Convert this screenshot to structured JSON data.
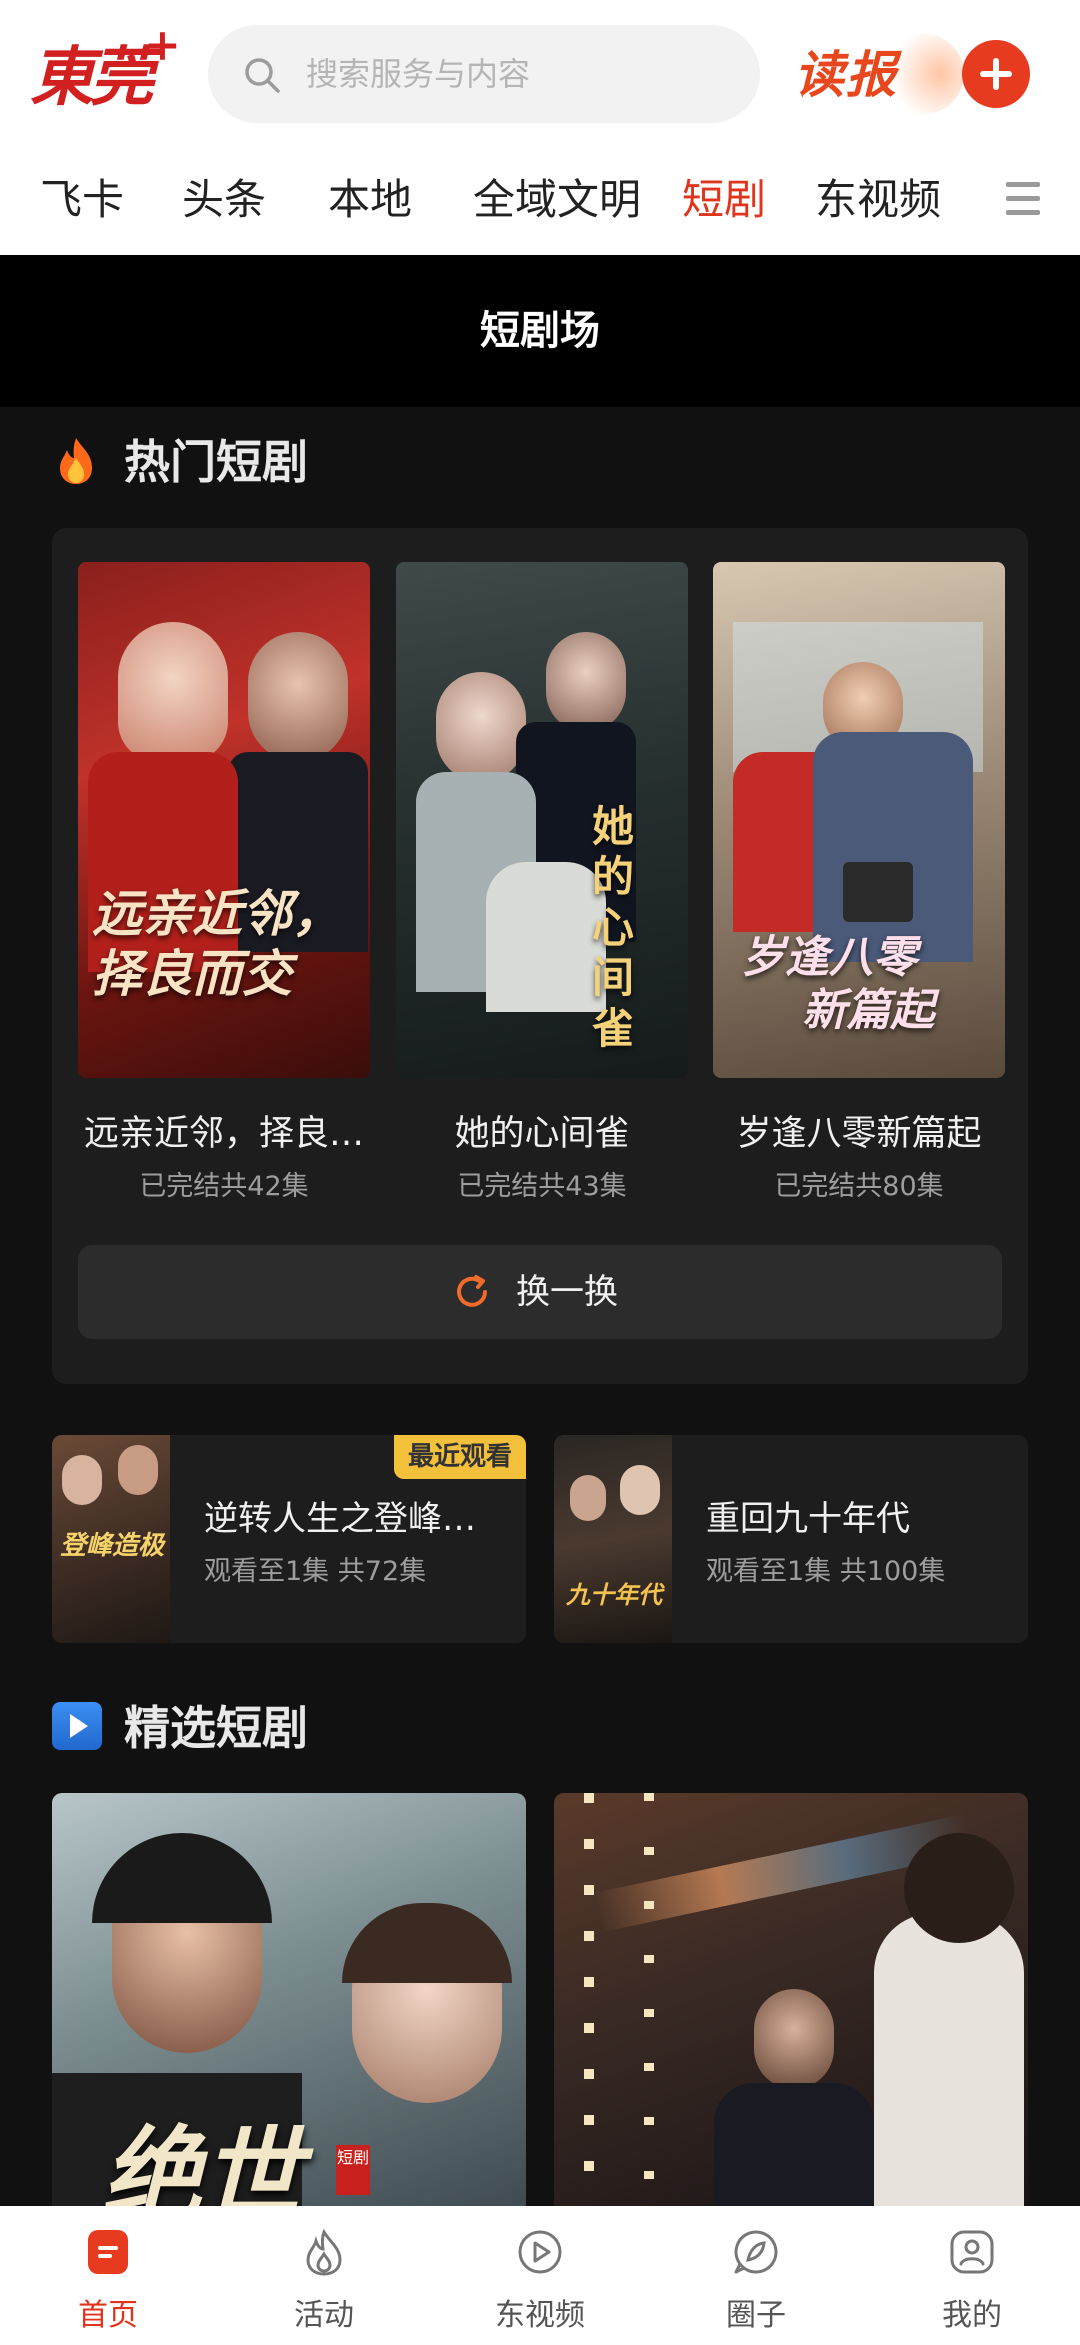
{
  "header": {
    "logo": "東莞",
    "logo_plus": "+",
    "search_placeholder": "搜索服务与内容",
    "dubao": "读报"
  },
  "tabs": [
    {
      "label": "飞卡",
      "active": false
    },
    {
      "label": "头条",
      "active": false
    },
    {
      "label": "本地",
      "active": false
    },
    {
      "label": "全域文明",
      "active": false
    },
    {
      "label": "短剧",
      "active": true
    },
    {
      "label": "东视频",
      "active": false
    }
  ],
  "page_title": "短剧场",
  "hot": {
    "title": "热门短剧",
    "items": [
      {
        "name": "远亲近邻，择良…",
        "status": "已完结共42集",
        "poster_text": "远亲近邻，择良而交"
      },
      {
        "name": "她的心间雀",
        "status": "已完结共43集",
        "poster_text": "她的心间雀"
      },
      {
        "name": "岁逢八零新篇起",
        "status": "已完结共80集",
        "poster_text": "岁逢八零 新篇起"
      }
    ],
    "refresh_label": "换一换"
  },
  "recent": {
    "badge": "最近观看",
    "items": [
      {
        "name": "逆转人生之登峰…",
        "progress": "观看至1集 共72集",
        "thumb_text": "登峰造极"
      },
      {
        "name": "重回九十年代",
        "progress": "观看至1集 共100集",
        "thumb_text": "九十年代"
      }
    ]
  },
  "featured": {
    "title": "精选短剧",
    "items": [
      {
        "poster_text": "绝世",
        "tag": "短剧"
      },
      {
        "poster_text": ""
      }
    ]
  },
  "bottom_nav": [
    {
      "label": "首页",
      "icon": "home-icon",
      "active": true
    },
    {
      "label": "活动",
      "icon": "flame-icon",
      "active": false
    },
    {
      "label": "东视频",
      "icon": "play-circle-icon",
      "active": false
    },
    {
      "label": "圈子",
      "icon": "leaf-chat-icon",
      "active": false
    },
    {
      "label": "我的",
      "icon": "profile-icon",
      "active": false
    }
  ],
  "colors": {
    "accent": "#e0341d",
    "badge": "#f2c03a",
    "card": "#1d1d1d"
  }
}
